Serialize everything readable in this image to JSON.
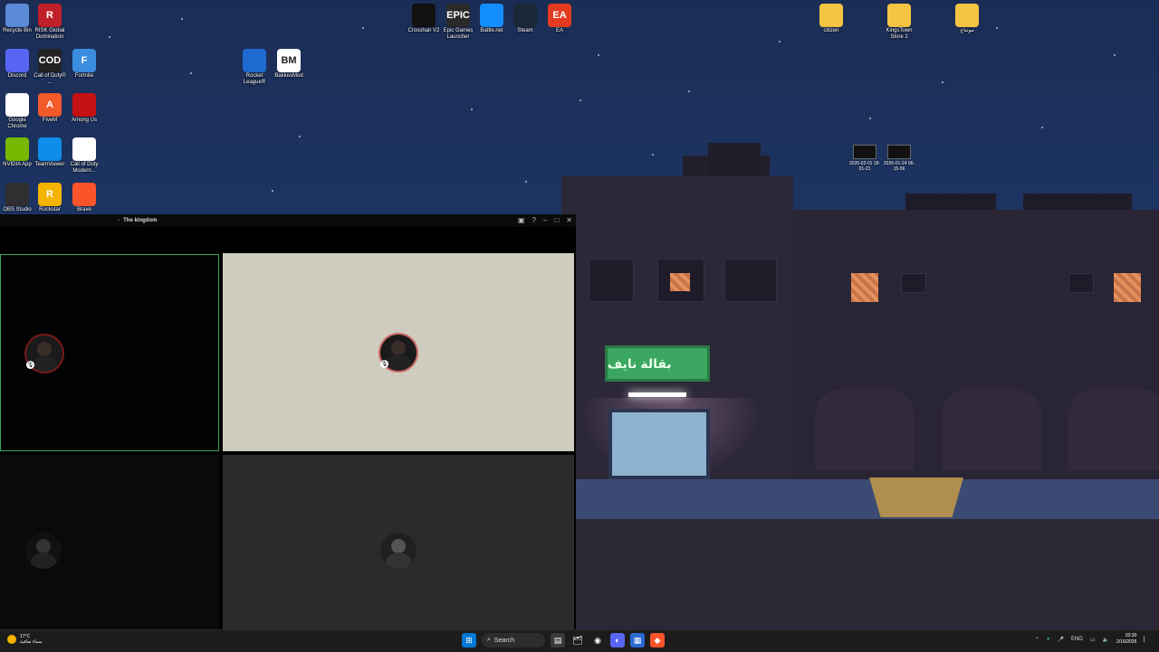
{
  "desktop": {
    "icons_left": [
      {
        "label": "Recycle Bin",
        "icon": "recycle-bin-icon",
        "color": "#5b8ad6"
      },
      {
        "label": "RISK Global Domination",
        "icon": "risk-icon",
        "color": "#c0202a",
        "glyph": "R"
      },
      {
        "label": "Discord",
        "icon": "discord-icon",
        "color": "#5865f2"
      },
      {
        "label": "Call of Duty® ...",
        "icon": "call-of-duty-icon",
        "color": "#222222",
        "glyph": "COD"
      },
      {
        "label": "Fortnite",
        "icon": "fortnite-icon",
        "color": "#3b8de0",
        "glyph": "F"
      },
      {
        "label": "Google Chrome",
        "icon": "chrome-icon",
        "color": "#ffffff"
      },
      {
        "label": "FiveM",
        "icon": "fivem-icon",
        "color": "#f25a2a",
        "glyph": "A"
      },
      {
        "label": "Among Us",
        "icon": "among-us-icon",
        "color": "#c51111"
      },
      {
        "label": "NVIDIA App",
        "icon": "nvidia-icon",
        "color": "#76b900"
      },
      {
        "label": "TeamViewer",
        "icon": "teamviewer-icon",
        "color": "#0e8ee9"
      },
      {
        "label": "Call of Duty Modern...",
        "icon": "document-icon",
        "color": "#ffffff"
      },
      {
        "label": "OBS Studio",
        "icon": "obs-icon",
        "color": "#302e31"
      },
      {
        "label": "Rockstar",
        "icon": "rockstar-icon",
        "color": "#f5b400",
        "glyph": "R"
      },
      {
        "label": "Brave",
        "icon": "brave-icon",
        "color": "#fb542b"
      }
    ],
    "icons_mid": [
      {
        "label": "Rocket League®",
        "icon": "rocket-league-icon",
        "color": "#1e6ad1"
      },
      {
        "label": "BakkesMod",
        "icon": "bakkesmod-icon",
        "color": "#ffffff",
        "glyph": "BM"
      }
    ],
    "icons_top": [
      {
        "label": "Crosshair V2",
        "icon": "crosshair-icon",
        "color": "#111111"
      },
      {
        "label": "Epic Games Launcher",
        "icon": "epic-games-icon",
        "color": "#2a2a2a",
        "glyph": "EPIC"
      },
      {
        "label": "Battle.net",
        "icon": "battlenet-icon",
        "color": "#148eff"
      },
      {
        "label": "Steam",
        "icon": "steam-icon",
        "color": "#1b2838"
      },
      {
        "label": "EA",
        "icon": "ea-icon",
        "color": "#e23b1f",
        "glyph": "EA"
      }
    ],
    "icons_right": [
      {
        "label": "citizen",
        "icon": "folder-icon",
        "color": "#f6c443"
      },
      {
        "label": "KingsTown Store 2",
        "icon": "folder-icon",
        "color": "#f6c443"
      },
      {
        "label": "مونتاج",
        "icon": "folder-icon",
        "color": "#f6c443"
      }
    ],
    "screenshots": [
      {
        "label": "2026-02-01 18-01-21"
      },
      {
        "label": "2026-01-24 06-15-56"
      }
    ]
  },
  "wallpaper": {
    "shop_sign": "بقالة نايف"
  },
  "call_window": {
    "title": "The kingdom",
    "accent": "#3ba55c"
  },
  "taskbar": {
    "weather_temp": "17°C",
    "weather_desc": "سماء صافية",
    "search_label": "Search",
    "language": "ENG",
    "time": "03:30",
    "date": "2/16/2026"
  }
}
